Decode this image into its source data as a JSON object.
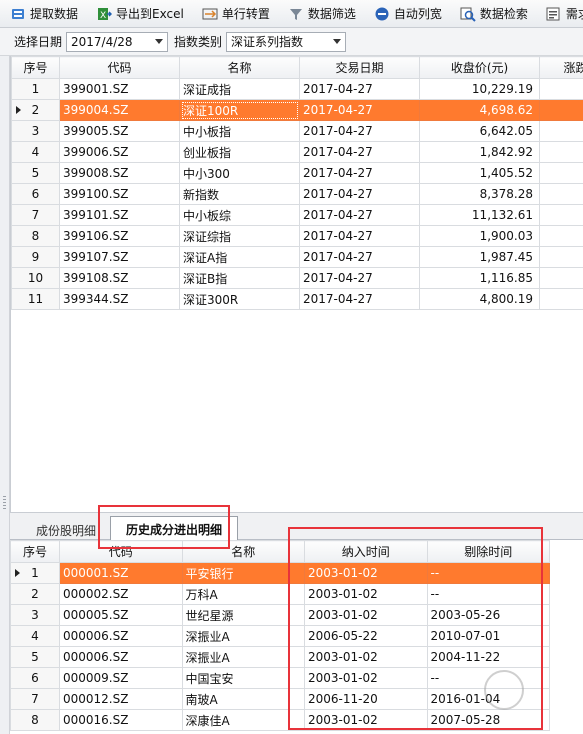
{
  "toolbar": {
    "buttons": [
      {
        "label": "提取数据",
        "icon": "fetch-data-icon"
      },
      {
        "label": "导出到Excel",
        "icon": "excel-export-icon"
      },
      {
        "label": "单行转置",
        "icon": "transpose-icon"
      },
      {
        "label": "数据筛选",
        "icon": "filter-icon"
      },
      {
        "label": "自动列宽",
        "icon": "auto-width-icon"
      },
      {
        "label": "数据检索",
        "icon": "search-icon"
      },
      {
        "label": "需求意",
        "icon": "feedback-icon"
      }
    ]
  },
  "filters": {
    "date_label": "选择日期",
    "date_value": "2017/4/28",
    "category_label": "指数类别",
    "category_value": "深证系列指数"
  },
  "top_table": {
    "columns": [
      "序号",
      "代码",
      "名称",
      "交易日期",
      "收盘价(元)",
      "涨跌"
    ],
    "rows": [
      {
        "idx": "1",
        "code": "399001.SZ",
        "name": "深证成指",
        "date": "2017-04-27",
        "close": "10,229.19"
      },
      {
        "idx": "2",
        "code": "399004.SZ",
        "name": "深证100R",
        "date": "2017-04-27",
        "close": "4,698.62"
      },
      {
        "idx": "3",
        "code": "399005.SZ",
        "name": "中小板指",
        "date": "2017-04-27",
        "close": "6,642.05"
      },
      {
        "idx": "4",
        "code": "399006.SZ",
        "name": "创业板指",
        "date": "2017-04-27",
        "close": "1,842.92"
      },
      {
        "idx": "5",
        "code": "399008.SZ",
        "name": "中小300",
        "date": "2017-04-27",
        "close": "1,405.52"
      },
      {
        "idx": "6",
        "code": "399100.SZ",
        "name": "新指数",
        "date": "2017-04-27",
        "close": "8,378.28"
      },
      {
        "idx": "7",
        "code": "399101.SZ",
        "name": "中小板综",
        "date": "2017-04-27",
        "close": "11,132.61"
      },
      {
        "idx": "8",
        "code": "399106.SZ",
        "name": "深证综指",
        "date": "2017-04-27",
        "close": "1,900.03"
      },
      {
        "idx": "9",
        "code": "399107.SZ",
        "name": "深证A指",
        "date": "2017-04-27",
        "close": "1,987.45"
      },
      {
        "idx": "10",
        "code": "399108.SZ",
        "name": "深证B指",
        "date": "2017-04-27",
        "close": "1,116.85"
      },
      {
        "idx": "11",
        "code": "399344.SZ",
        "name": "深证300R",
        "date": "2017-04-27",
        "close": "4,800.19"
      }
    ]
  },
  "tabs": {
    "inactive": "成份股明细",
    "active": "历史成分进出明细"
  },
  "bottom_table": {
    "columns": [
      "序号",
      "代码",
      "名称",
      "纳入时间",
      "剔除时间"
    ],
    "rows": [
      {
        "idx": "1",
        "code": "000001.SZ",
        "name": "平安银行",
        "in": "2003-01-02",
        "out": "--"
      },
      {
        "idx": "2",
        "code": "000002.SZ",
        "name": "万科A",
        "in": "2003-01-02",
        "out": "--"
      },
      {
        "idx": "3",
        "code": "000005.SZ",
        "name": "世纪星源",
        "in": "2003-01-02",
        "out": "2003-05-26"
      },
      {
        "idx": "4",
        "code": "000006.SZ",
        "name": "深振业A",
        "in": "2006-05-22",
        "out": "2010-07-01"
      },
      {
        "idx": "5",
        "code": "000006.SZ",
        "name": "深振业A",
        "in": "2003-01-02",
        "out": "2004-11-22"
      },
      {
        "idx": "6",
        "code": "000009.SZ",
        "name": "中国宝安",
        "in": "2003-01-02",
        "out": "--"
      },
      {
        "idx": "7",
        "code": "000012.SZ",
        "name": "南玻A",
        "in": "2006-11-20",
        "out": "2016-01-04"
      },
      {
        "idx": "8",
        "code": "000016.SZ",
        "name": "深康佳A",
        "in": "2003-01-02",
        "out": "2007-05-28"
      }
    ]
  },
  "colors": {
    "selection": "#ff7a2e",
    "highlight_box": "#e8333a"
  }
}
